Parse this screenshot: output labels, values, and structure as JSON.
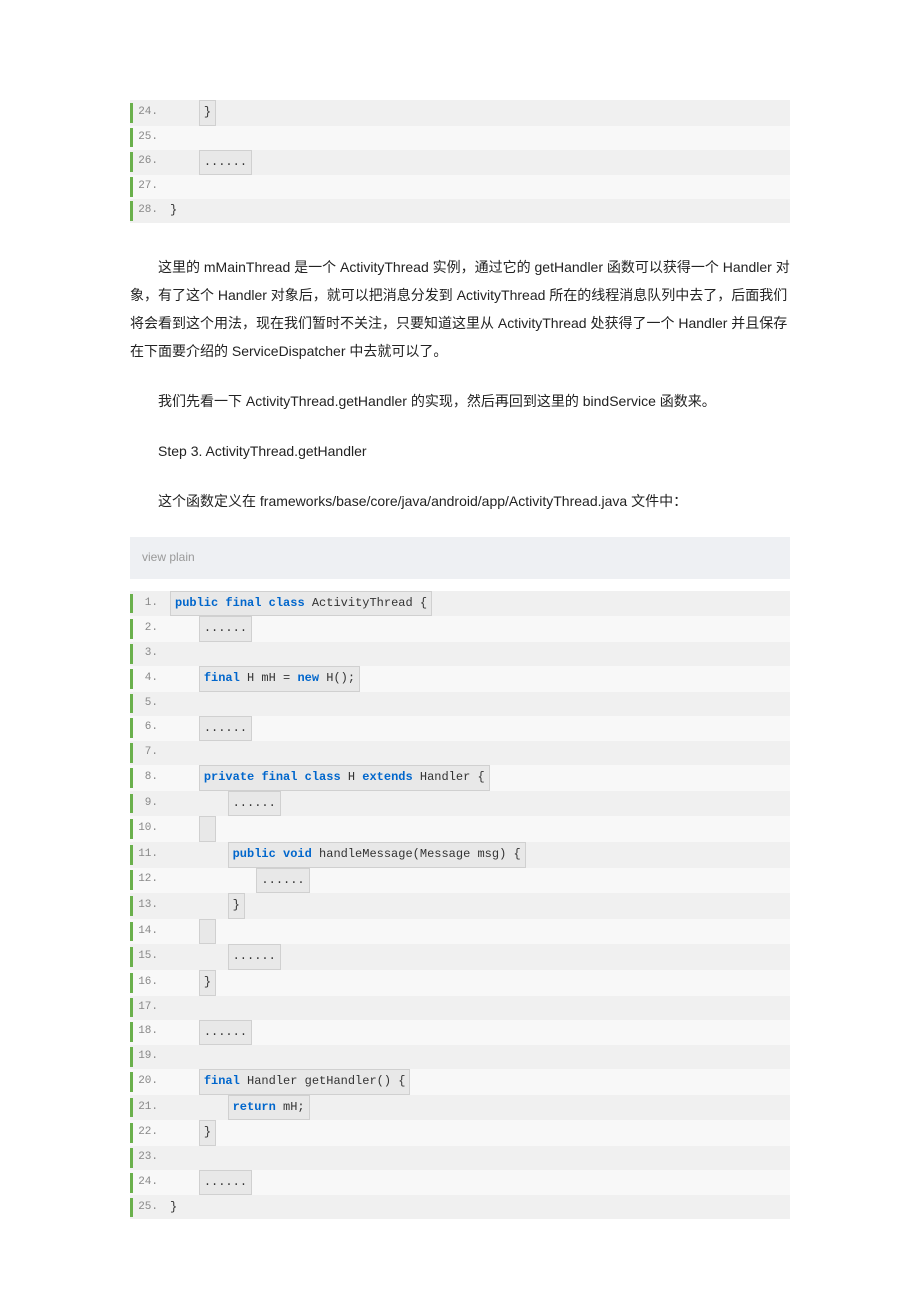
{
  "block1": {
    "lines": [
      {
        "n": "24.",
        "pre": "    ",
        "text": "}",
        "hl": true
      },
      {
        "n": "25.",
        "pre": "",
        "text": "",
        "hl": false
      },
      {
        "n": "26.",
        "pre": "    ",
        "text": "......",
        "hl": true
      },
      {
        "n": "27.",
        "pre": "",
        "text": "",
        "hl": false
      },
      {
        "n": "28.",
        "pre": "",
        "text": "}",
        "hl": false
      }
    ]
  },
  "para1": "这里的 mMainThread 是一个 ActivityThread 实例，通过它的 getHandler 函数可以获得一个 Handler 对象，有了这个 Handler 对象后，就可以把消息分发到 ActivityThread 所在的线程消息队列中去了，后面我们将会看到这个用法，现在我们暂时不关注，只要知道这里从 ActivityThread 处获得了一个 Handler 并且保存在下面要介绍的 ServiceDispatcher 中去就可以了。",
  "para2": "我们先看一下 ActivityThread.getHandler 的实现，然后再回到这里的 bindService 函数来。",
  "para3": "Step 3. ActivityThread.getHandler",
  "para4": "这个函数定义在 frameworks/base/core/java/android/app/ActivityThread.java 文件中：",
  "viewplain": "view plain",
  "block2": {
    "lines": [
      {
        "n": "1.",
        "html": "<span class=\"kw\">public</span> <span class=\"kw\">final</span> <span class=\"kw\">class</span> ActivityThread {",
        "hl": true
      },
      {
        "n": "2.",
        "pre": "    ",
        "text": "......",
        "hl": true
      },
      {
        "n": "3.",
        "pre": "",
        "text": "",
        "hl": false
      },
      {
        "n": "4.",
        "pre": "    ",
        "html": "<span class=\"kw\">final</span> H mH = <span class=\"kw\">new</span> H();",
        "hl": true
      },
      {
        "n": "5.",
        "pre": "",
        "text": "",
        "hl": false
      },
      {
        "n": "6.",
        "pre": "    ",
        "text": "......",
        "hl": true
      },
      {
        "n": "7.",
        "pre": "",
        "text": "",
        "hl": false
      },
      {
        "n": "8.",
        "pre": "    ",
        "html": "<span class=\"kw\">private</span> <span class=\"kw\">final</span> <span class=\"kw\">class</span> H <span class=\"kw\">extends</span> Handler {",
        "hl": true
      },
      {
        "n": "9.",
        "pre": "        ",
        "text": "......",
        "hl": true
      },
      {
        "n": "10.",
        "pre": "    ",
        "text": "",
        "hl": true
      },
      {
        "n": "11.",
        "pre": "        ",
        "html": "<span class=\"kw\">public</span> <span class=\"kw\">void</span> handleMessage(Message msg) {",
        "hl": true
      },
      {
        "n": "12.",
        "pre": "            ",
        "text": "......",
        "hl": true
      },
      {
        "n": "13.",
        "pre": "        ",
        "text": "}",
        "hl": true
      },
      {
        "n": "14.",
        "pre": "    ",
        "text": "",
        "hl": true
      },
      {
        "n": "15.",
        "pre": "        ",
        "text": "......",
        "hl": true
      },
      {
        "n": "16.",
        "pre": "    ",
        "text": "}",
        "hl": true
      },
      {
        "n": "17.",
        "pre": "",
        "text": "",
        "hl": false
      },
      {
        "n": "18.",
        "pre": "    ",
        "text": "......",
        "hl": true
      },
      {
        "n": "19.",
        "pre": "",
        "text": "",
        "hl": false
      },
      {
        "n": "20.",
        "pre": "    ",
        "html": "<span class=\"kw\">final</span> Handler getHandler() {",
        "hl": true
      },
      {
        "n": "21.",
        "pre": "        ",
        "html": "<span class=\"kw\">return</span> mH;",
        "hl": true
      },
      {
        "n": "22.",
        "pre": "    ",
        "text": "}",
        "hl": true
      },
      {
        "n": "23.",
        "pre": "",
        "text": "",
        "hl": false
      },
      {
        "n": "24.",
        "pre": "    ",
        "text": "......",
        "hl": true
      },
      {
        "n": "25.",
        "pre": "",
        "text": "}",
        "hl": false
      }
    ]
  }
}
